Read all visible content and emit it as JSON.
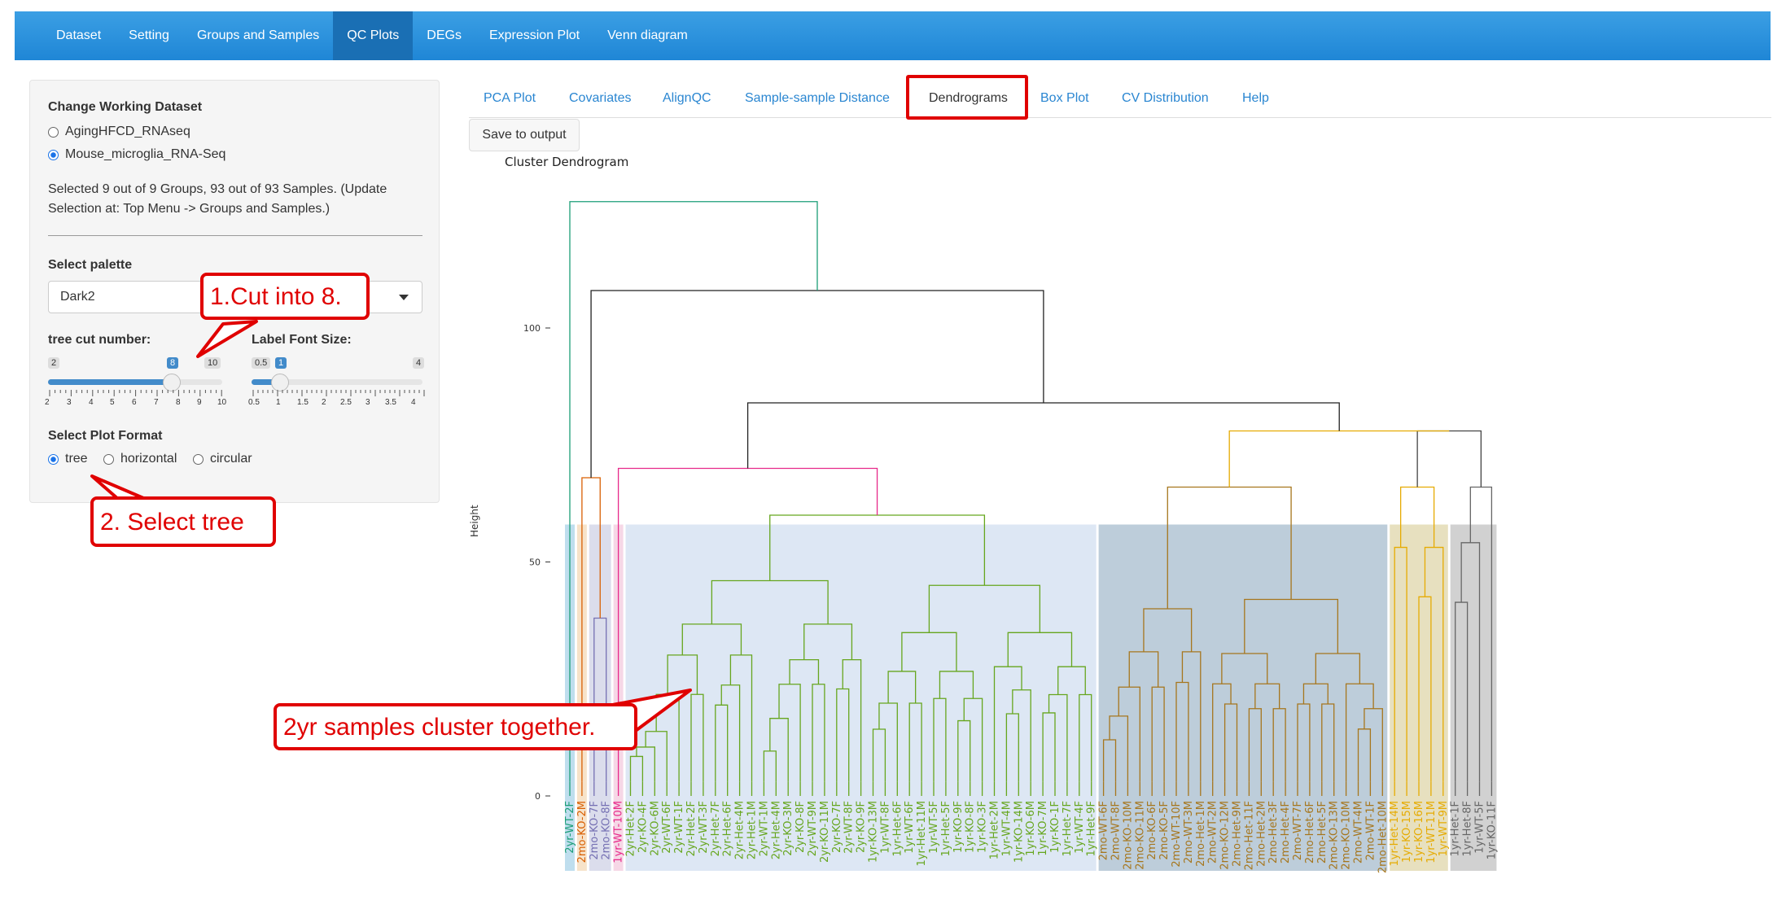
{
  "navbar": {
    "items": [
      "Dataset",
      "Setting",
      "Groups and Samples",
      "QC Plots",
      "DEGs",
      "Expression Plot",
      "Venn diagram"
    ],
    "active": "QC Plots"
  },
  "sidebar": {
    "dataset_heading": "Change Working Dataset",
    "datasets": [
      {
        "label": "AgingHFCD_RNAseq",
        "selected": false
      },
      {
        "label": "Mouse_microglia_RNA-Seq",
        "selected": true
      }
    ],
    "selection_info": "Selected 9 out of 9 Groups, 93 out of 93 Samples. (Update Selection at: Top Menu -> Groups and Samples.)",
    "palette_label": "Select palette",
    "palette_value": "Dark2",
    "tree_cut": {
      "label": "tree cut number:",
      "min": "2",
      "max": "10",
      "value": "8",
      "ticks": [
        "2",
        "3",
        "4",
        "5",
        "6",
        "7",
        "8",
        "9",
        "10"
      ]
    },
    "font_size": {
      "label": "Label Font Size:",
      "min": "0.5",
      "max": "4",
      "value": "1",
      "ticks": [
        "0.5",
        "1",
        "1.5",
        "2",
        "2.5",
        "3",
        "3.5",
        "4"
      ]
    },
    "plot_format_label": "Select Plot Format",
    "plot_formats": [
      {
        "label": "tree",
        "selected": true
      },
      {
        "label": "horizontal",
        "selected": false
      },
      {
        "label": "circular",
        "selected": false
      }
    ]
  },
  "tabs": {
    "items": [
      "PCA Plot",
      "Covariates",
      "AlignQC",
      "Sample-sample Distance",
      "Dendrograms",
      "Box Plot",
      "CV Distribution",
      "Help"
    ],
    "active": "Dendrograms"
  },
  "save_button": "Save to output",
  "plot": {
    "title": "Cluster Dendrogram",
    "ylabel": "Height",
    "yticks": [
      "0",
      "50",
      "100"
    ],
    "leaves": [
      "2yr-WT-2F",
      "2mo-KO-2M",
      "2mo-KO-7F",
      "2mo-KO-8F",
      "1yr-WT-10M",
      "2yr-Het-2F",
      "2yr-KO-4F",
      "2yr-KO-6M",
      "2yr-WT-6F",
      "2yr-WT-1F",
      "2yr-Het-2F",
      "2yr-WT-3F",
      "2yr-Het-7F",
      "2yr-Het-6F",
      "2yr-Het-4M",
      "2yr-Het-1M",
      "2yr-WT-1M",
      "2yr-Het-4M",
      "2yr-KO-3M",
      "2yr-KO-8F",
      "2yr-WT-9M",
      "2yr-KO-11M",
      "2yr-KO-7F",
      "2yr-WT-8F",
      "2yr-KO-9F",
      "1yr-KO-13M",
      "1yr-WT-8F",
      "1yr-Het-6F",
      "1yr-WT-6F",
      "1yr-Het-11M",
      "1yr-WT-5F",
      "1yr-Het-5F",
      "1yr-KO-9F",
      "1yr-KO-8F",
      "1yr-KO-3F",
      "1yr-Het-2M",
      "1yr-WT-4M",
      "1yr-KO-14M",
      "1yr-KO-6M",
      "1yr-KO-7M",
      "1yr-KO-1F",
      "1yr-Het-7F",
      "1yr-WT-4F",
      "1yr-Het-9F",
      "2mo-WT-6F",
      "2mo-WT-8F",
      "2mo-KO-10M",
      "2mo-KO-11M",
      "2mo-KO-6F",
      "2mo-KO-5F",
      "2mo-WT-10F",
      "2mo-WT-3M",
      "2mo-Het-1M",
      "2mo-WT-2M",
      "2mo-KO-12M",
      "2mo-Het-9M",
      "2mo-Het-11F",
      "2mo-Het-2M",
      "2mo-Het-3F",
      "2mo-Het-4F",
      "2mo-WT-7F",
      "2mo-Het-6F",
      "2mo-Het-5F",
      "2mo-KO-13M",
      "2mo-KO-10M",
      "2mo-WT-4M",
      "2mo-WT-1F",
      "2mo-Het-10M",
      "1yr-Het-14M",
      "1yr-KO-15M",
      "1yr-KO-16M",
      "1yr-WT-11M",
      "1yr-WT-9M",
      "1yr-Het-1F",
      "1yr-Het-8F",
      "1yr-WT-5F",
      "1yr-KO-11F"
    ],
    "colors": [
      "#1b9e77",
      "#d95f02",
      "#7570b3",
      "#e7298a",
      "#66a61e",
      "#e6ab02",
      "#a6761d",
      "#666666"
    ]
  },
  "callouts": {
    "cut": "1.Cut into 8.",
    "tree": "2. Select tree",
    "cluster": "2yr samples cluster together."
  }
}
